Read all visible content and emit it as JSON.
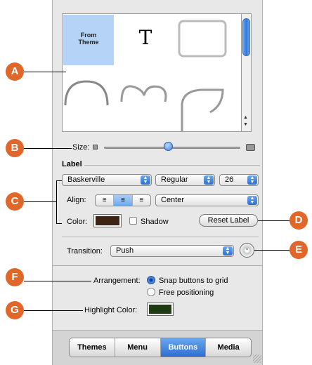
{
  "theme_grid": {
    "from_theme_label": "From\nTheme",
    "text_glyph": "T"
  },
  "size": {
    "label": "Size:",
    "value_fraction": 0.5
  },
  "label_section": {
    "heading": "Label",
    "font": "Baskerville",
    "style": "Regular",
    "font_size": "26",
    "align_label": "Align:",
    "align_selected": "center",
    "align_popup": "Center",
    "color_label": "Color:",
    "color_value": "#3d2414",
    "shadow_label": "Shadow",
    "reset_button": "Reset Label"
  },
  "transition": {
    "label": "Transition:",
    "value": "Push"
  },
  "arrangement": {
    "label": "Arrangement:",
    "options": [
      "Snap buttons to grid",
      "Free positioning"
    ],
    "selected": 0
  },
  "highlight": {
    "label": "Highlight Color:",
    "color_value": "#1e3a12"
  },
  "tabs": {
    "items": [
      "Themes",
      "Menu",
      "Buttons",
      "Media"
    ],
    "active": "Buttons"
  },
  "callouts": [
    "A",
    "B",
    "C",
    "D",
    "E",
    "F",
    "G"
  ],
  "colors": {
    "accent": "#2d6fd1",
    "callout": "#e0662a"
  }
}
